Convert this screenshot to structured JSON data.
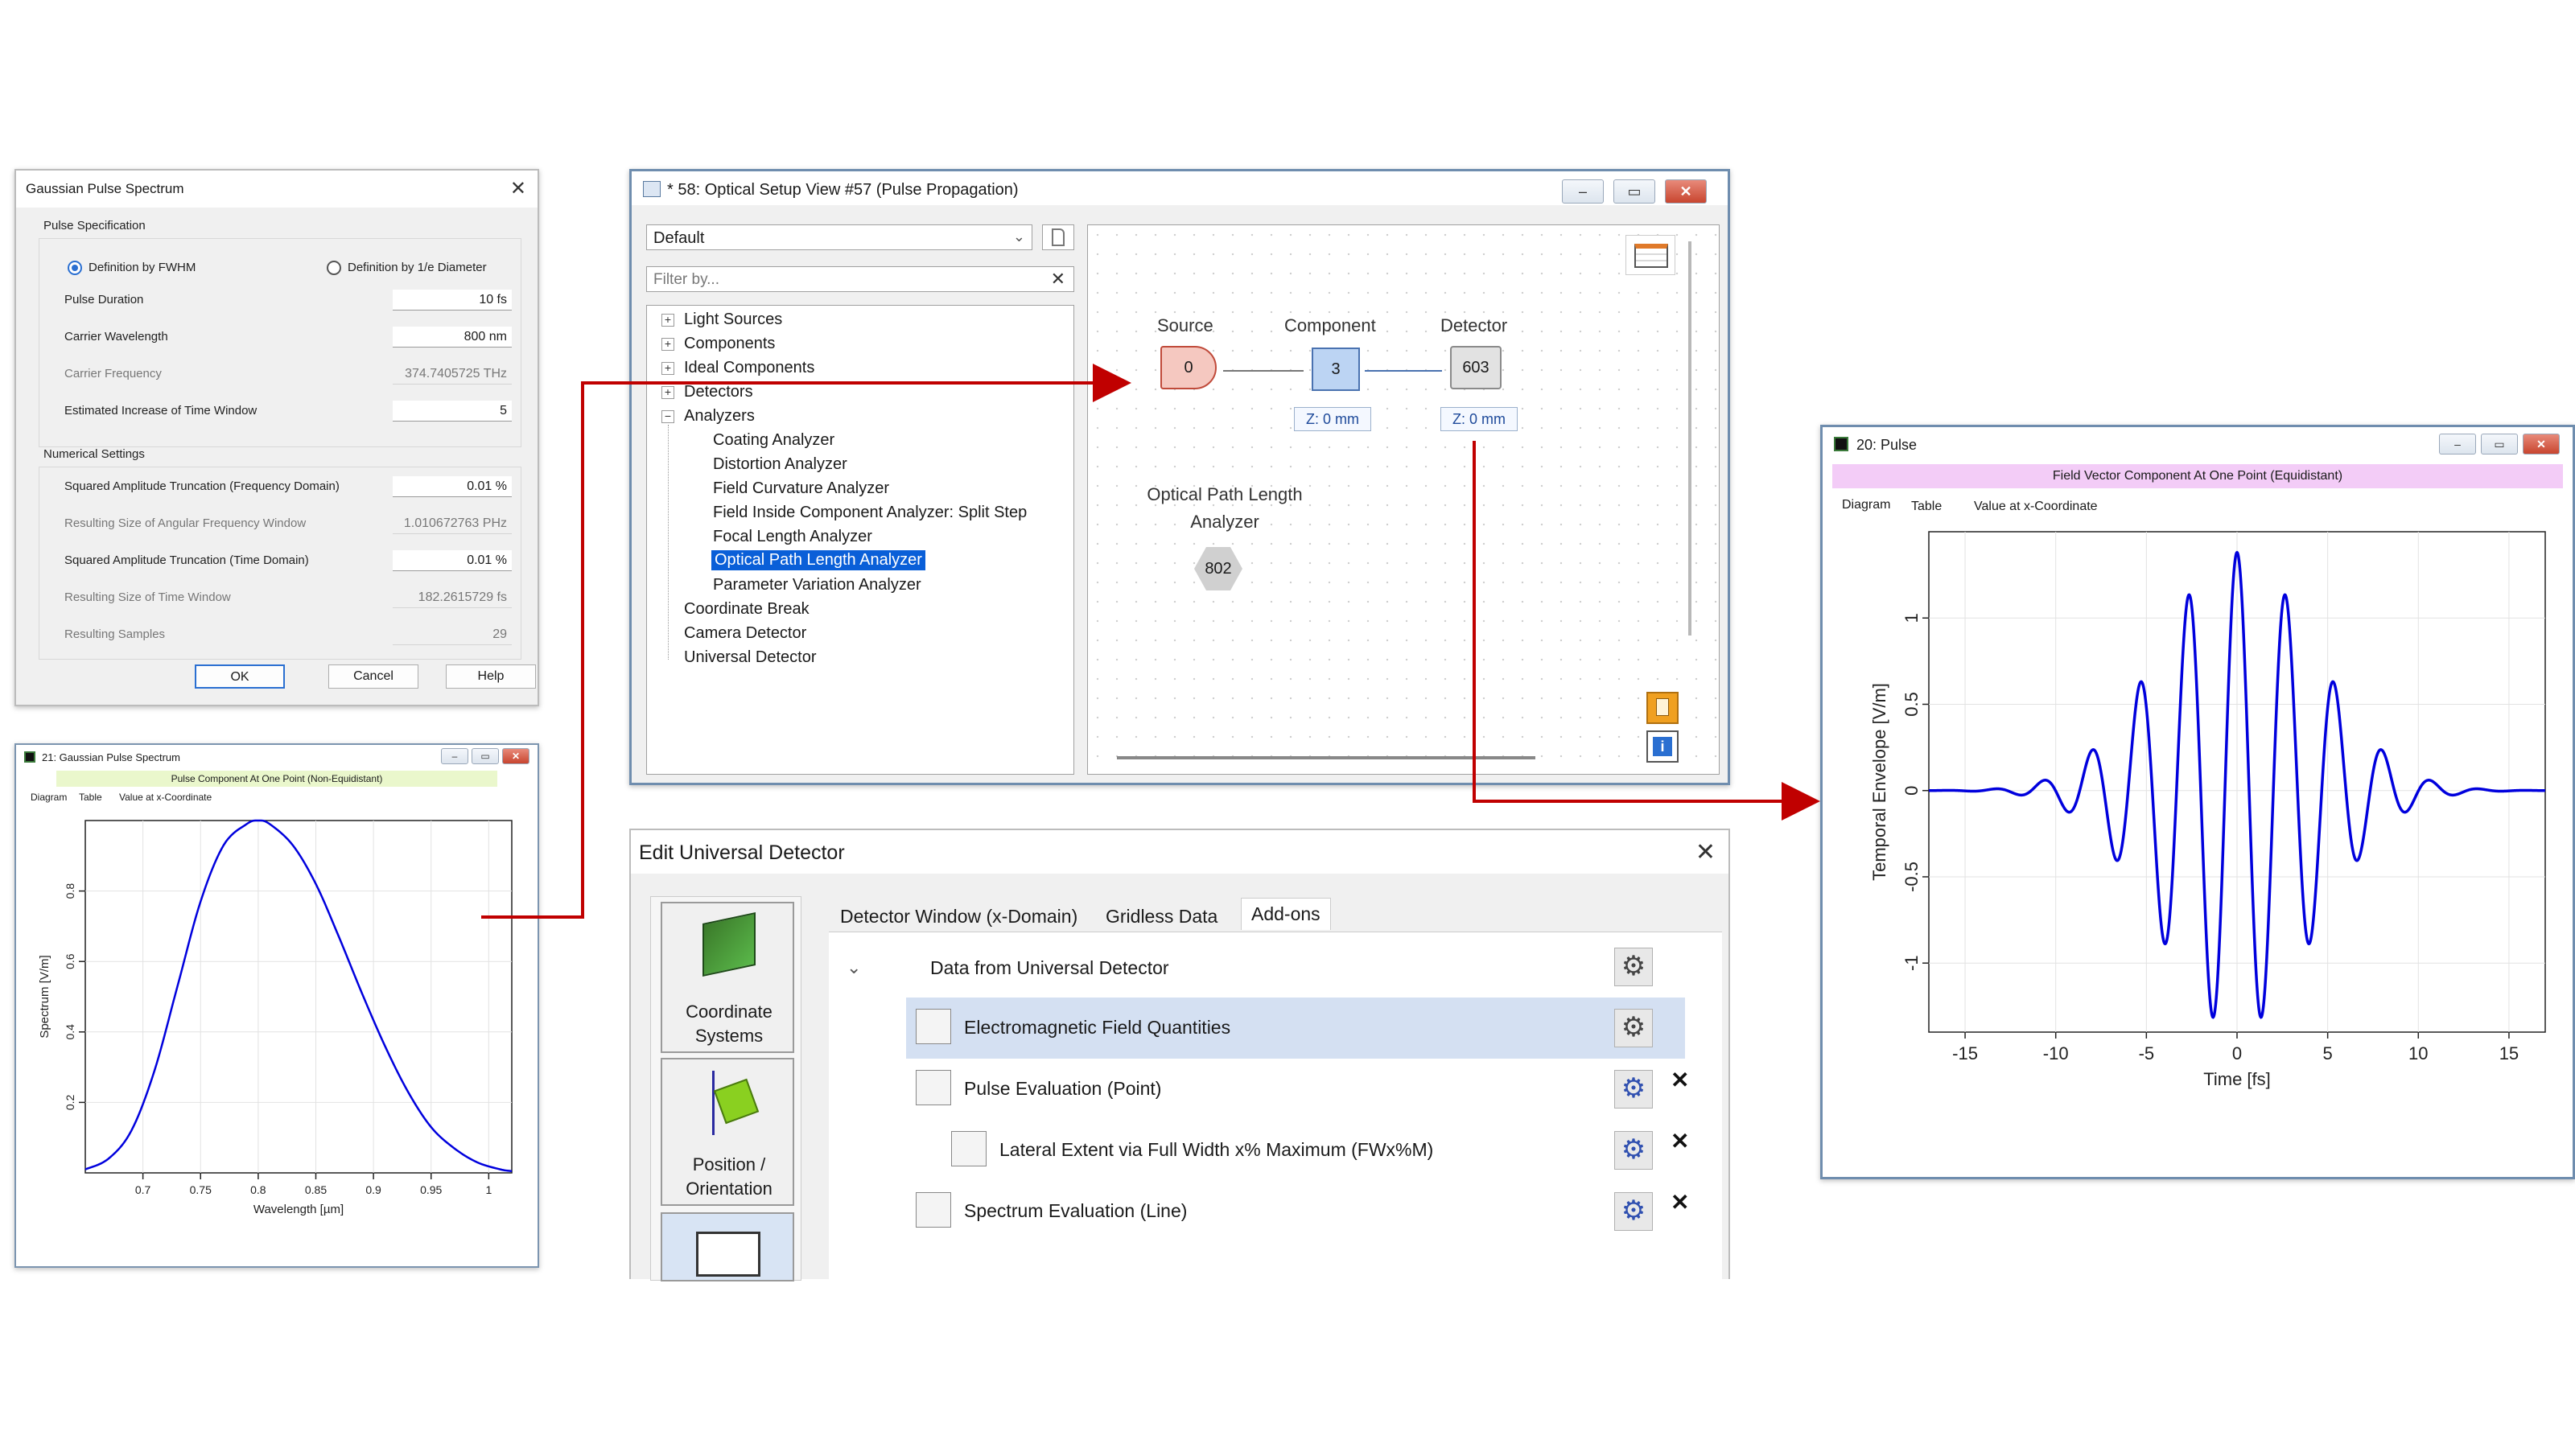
{
  "gauss_dialog": {
    "title": "Gaussian Pulse Spectrum",
    "group_pulse": "Pulse Specification",
    "radio_fwhm": "Definition by FWHM",
    "radio_diam": "Definition by 1/e Diameter",
    "pulse_duration_label": "Pulse Duration",
    "pulse_duration_value": "10 fs",
    "carrier_wavelength_label": "Carrier Wavelength",
    "carrier_wavelength_value": "800 nm",
    "carrier_frequency_label": "Carrier Frequency",
    "carrier_frequency_value": "374.7405725 THz",
    "est_increase_label": "Estimated Increase of Time Window",
    "est_increase_value": "5",
    "group_numerical": "Numerical Settings",
    "sq_amp_freq_label": "Squared Amplitude Truncation (Frequency Domain)",
    "sq_amp_freq_value": "0.01 %",
    "res_ang_freq_label": "Resulting Size of Angular Frequency Window",
    "res_ang_freq_value": "1.010672763 PHz",
    "sq_amp_time_label": "Squared Amplitude Truncation (Time Domain)",
    "sq_amp_time_value": "0.01 %",
    "res_time_label": "Resulting Size of Time Window",
    "res_time_value": "182.2615729 fs",
    "res_samples_label": "Resulting Samples",
    "res_samples_value": "29",
    "ok": "OK",
    "cancel": "Cancel",
    "help": "Help"
  },
  "spectrum_window": {
    "title": "21: Gaussian Pulse Spectrum",
    "subtitle": "Pulse Component At One Point (Non-Equidistant)",
    "tabs": [
      "Diagram",
      "Table",
      "Value at x-Coordinate"
    ]
  },
  "setup_window": {
    "title": "* 58: Optical Setup View #57 (Pulse Propagation)",
    "dropdown_value": "Default",
    "filter_placeholder": "Filter by...",
    "tree": {
      "light_sources": "Light Sources",
      "components": "Components",
      "ideal_components": "Ideal Components",
      "detectors": "Detectors",
      "analyzers": "Analyzers",
      "analyzer_items": [
        "Coating Analyzer",
        "Distortion Analyzer",
        "Field Curvature Analyzer",
        "Field Inside Component Analyzer: Split Step",
        "Focal Length Analyzer",
        "Optical Path Length Analyzer",
        "Parameter Variation Analyzer"
      ],
      "coordinate_break": "Coordinate Break",
      "camera_detector": "Camera Detector",
      "universal_detector": "Universal Detector"
    },
    "nodes": {
      "source_label": "Source",
      "source_id": "0",
      "component_label": "Component",
      "component_id": "3",
      "component_z": "Z: 0 mm",
      "detector_label": "Detector",
      "detector_id": "603",
      "detector_z": "Z: 0 mm",
      "opl_label_1": "Optical Path Length",
      "opl_label_2": "Analyzer",
      "opl_id": "802"
    }
  },
  "detector_dialog": {
    "title": "Edit Universal Detector",
    "side_items": [
      {
        "label_1": "Coordinate",
        "label_2": "Systems"
      },
      {
        "label_1": "Position /",
        "label_2": "Orientation"
      }
    ],
    "tabs": [
      "Detector Window (x-Domain)",
      "Gridless Data",
      "Add-ons"
    ],
    "items": {
      "root": "Data from Universal Detector",
      "em": "Electromagnetic Field Quantities",
      "pulse_eval": "Pulse Evaluation (Point)",
      "lateral": "Lateral Extent via Full Width x% Maximum (FWx%M)",
      "spectrum_eval": "Spectrum Evaluation (Line)"
    }
  },
  "pulse_window": {
    "title": "20: Pulse",
    "subtitle": "Field Vector Component At One Point (Equidistant)",
    "tabs": [
      "Diagram",
      "Table",
      "Value at x-Coordinate"
    ]
  },
  "colors": {
    "curve": "#0000dd",
    "arrow": "#c00000",
    "subtitle_bg_spectrum": "#eaf7cc",
    "subtitle_bg_pulse": "#f3ccf7",
    "selection": "#0a5fd8"
  },
  "chart_data": [
    {
      "type": "line",
      "title": "",
      "xlabel": "Wavelength [µm]",
      "ylabel": "Spectrum [V/m]",
      "xlim": [
        0.65,
        1.02
      ],
      "ylim": [
        0,
        1.0
      ],
      "xticks": [
        0.7,
        0.75,
        0.8,
        0.85,
        0.9,
        0.95,
        1
      ],
      "yticks": [
        0.2,
        0.4,
        0.6,
        0.8
      ],
      "x": [
        0.65,
        0.67,
        0.69,
        0.71,
        0.73,
        0.75,
        0.77,
        0.79,
        0.8,
        0.81,
        0.83,
        0.85,
        0.87,
        0.89,
        0.91,
        0.93,
        0.95,
        0.97,
        0.99,
        1.01,
        1.02
      ],
      "y": [
        0.01,
        0.04,
        0.12,
        0.29,
        0.53,
        0.77,
        0.93,
        0.99,
        1.0,
        0.99,
        0.93,
        0.82,
        0.67,
        0.51,
        0.36,
        0.23,
        0.13,
        0.07,
        0.03,
        0.01,
        0.005
      ]
    },
    {
      "type": "line",
      "title": "",
      "xlabel": "Time [fs]",
      "ylabel": "Temporal Envelope [V/m]",
      "xlim": [
        -17,
        17
      ],
      "ylim": [
        -1.4,
        1.5
      ],
      "xticks": [
        -15,
        -10,
        -5,
        0,
        5,
        10,
        15
      ],
      "yticks": [
        -1,
        -0.5,
        0,
        0.5,
        1
      ],
      "series": [
        {
          "pulse_fwhm_fs": 10,
          "carrier_period_fs": 2.67,
          "amplitude": 1.38
        }
      ]
    }
  ]
}
